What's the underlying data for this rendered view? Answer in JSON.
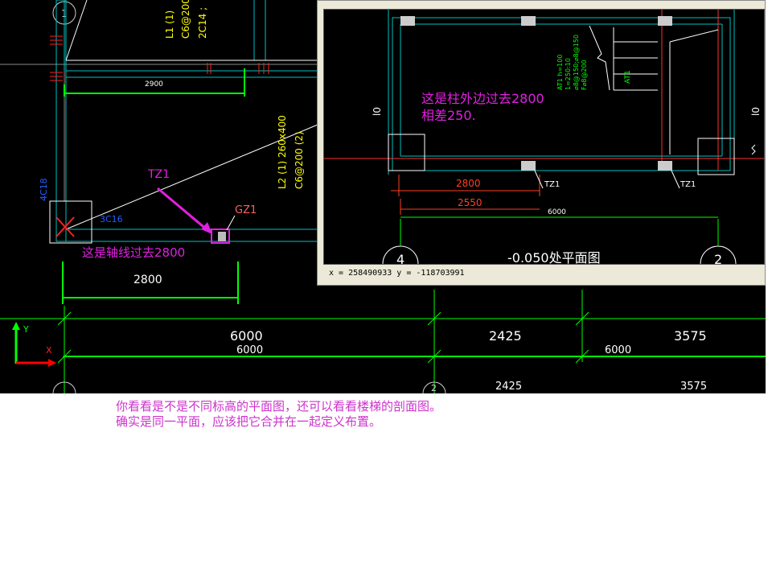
{
  "main_drawing": {
    "grid_bubble_top": "1",
    "beam_label_L1": "L1 (1)",
    "beam_label_L1_rebar": "C6@200",
    "beam_label_L1_bars": "2C14 ;",
    "dim_2900": "2900",
    "beam_label_L2": "L2 (1)  260x400",
    "beam_label_L2_rebar": "C6@200 (2)",
    "left_rebar_label": "4C18",
    "column_rebar_label": "3C16",
    "tz1_label": "TZ1",
    "gz1_label": "GZ1",
    "annotation_axis": "这是轴线过去2800",
    "dim_2800": "2800",
    "dim_6000_upper": "6000",
    "dim_6000_lower": "6000",
    "dim_2425_upper": "2425",
    "dim_3575_upper": "3575",
    "dim_6000_right": "6000",
    "dim_2425_lower": "2425",
    "dim_3575_lower": "3575",
    "ucs_y": "Y",
    "ucs_x": "X",
    "grid_bubble_bottom": "2"
  },
  "popup": {
    "annotation_line1": "这是柱外边过去2800",
    "annotation_line2": "相差250.",
    "stair_label": "AT1",
    "stair_rebar_1": "AT1 h=100",
    "stair_rebar_2": "1=250:10",
    "stair_rebar_3": "⌀8@150;⌀8@150",
    "stair_rebar_4": "F⌀8@200",
    "dim_2800": "2800",
    "dim_2550": "2550",
    "dim_6000": "6000",
    "tz1_a": "TZ1",
    "tz1_b": "TZ1",
    "bubble_left": "4",
    "bubble_right": "2",
    "title_partial": "-0.050处平面图",
    "side_mark_left": "l0",
    "side_mark_right": "l0",
    "status_text": "x = 258490933  y = -118703991"
  },
  "caption": {
    "line1": "你看看是不是不同标高的平面图，还可以看看楼梯的剖面图。",
    "line2": "确实是同一平面，应该把它合并在一起定义布置。"
  },
  "colors": {
    "background": "#000000",
    "dimension_green": "#00ff00",
    "wall_cyan": "#00c0c0",
    "text_yellow": "#ffff00",
    "annotation_magenta": "#e020e0",
    "axis_red": "#ff0000",
    "dim_red": "#ff4020"
  }
}
